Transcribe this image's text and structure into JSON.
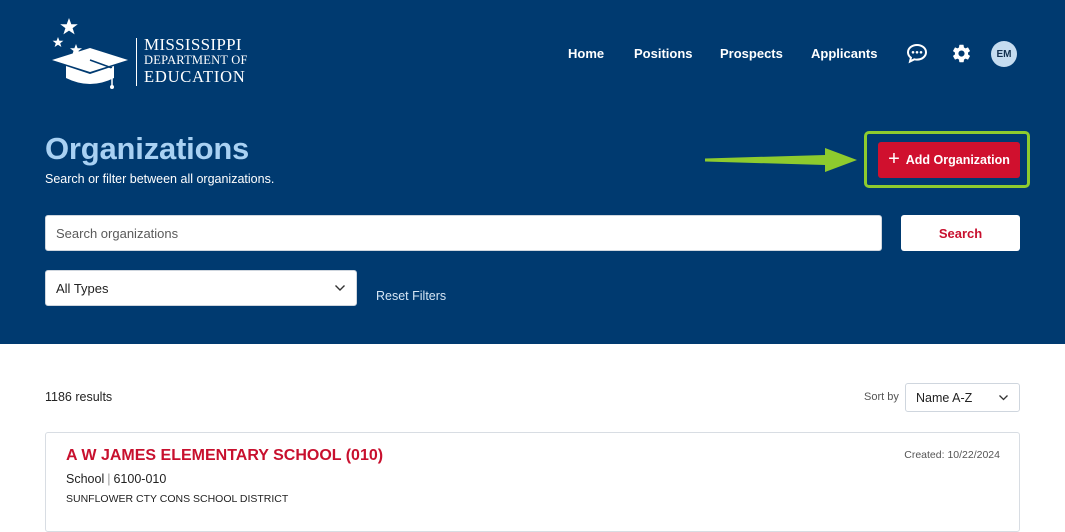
{
  "logo": {
    "line1": "MISSISSIPPI",
    "line2": "DEPARTMENT OF",
    "line3": "EDUCATION"
  },
  "nav": {
    "items": [
      {
        "label": "Home"
      },
      {
        "label": "Positions"
      },
      {
        "label": "Prospects"
      },
      {
        "label": "Applicants"
      }
    ],
    "icons": [
      "chat-icon",
      "gear-icon"
    ],
    "avatar_initials": "EM"
  },
  "header": {
    "title": "Organizations",
    "subtitle": "Search or filter between all organizations.",
    "add_button_label": "Add Organization",
    "add_button_icon": "plus-icon"
  },
  "search": {
    "placeholder": "Search organizations",
    "value": "",
    "button_label": "Search"
  },
  "filters": {
    "type_selected": "All Types",
    "reset_label": "Reset Filters"
  },
  "results": {
    "count_text": "1186 results",
    "sort_label": "Sort by",
    "sort_selected": "Name A-Z",
    "items": [
      {
        "name": "A W JAMES ELEMENTARY SCHOOL (010)",
        "created": "Created: 10/22/2024",
        "type": "School",
        "code": "6100-010",
        "district": "SUNFLOWER CTY CONS SCHOOL DISTRICT"
      }
    ]
  },
  "colors": {
    "hero_bg": "#003a70",
    "accent_red": "#d0102e",
    "title_blue": "#a9d1f3",
    "highlight_green": "#8ecb2e"
  }
}
